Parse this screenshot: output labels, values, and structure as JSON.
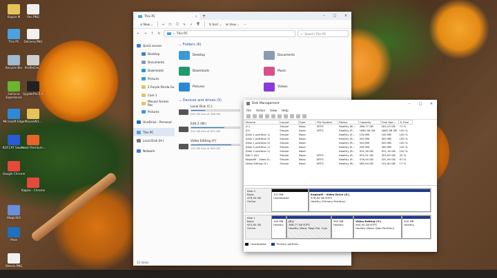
{
  "desktop": {
    "icons": [
      {
        "label": "Kagiso M",
        "col": "#e6c35a"
      },
      {
        "label": "Rec.PNG",
        "col": "#f0f0f0"
      },
      {
        "label": "This PC",
        "col": "#4aa3e0"
      },
      {
        "label": "Delivery.PNG",
        "col": "#f0f0f0"
      },
      {
        "label": "Recycle Bin",
        "col": "#9fb9d0"
      },
      {
        "label": "ProfileCre...",
        "col": "#cfcfcf"
      },
      {
        "label": "GeForce Experience",
        "col": "#6bb52f"
      },
      {
        "label": "SpyderPro 5.5",
        "col": "#222"
      },
      {
        "label": "Microsoft Edge",
        "col": "#2d8ad8"
      },
      {
        "label": "MouseWit...",
        "col": "#e6c35a"
      },
      {
        "label": "ROCCAT Swarm",
        "col": "#2a5ad8"
      },
      {
        "label": "Avast Premium...",
        "col": "#e8642a"
      },
      {
        "label": "Google Chrome",
        "col": "#e34a3b"
      },
      {
        "label": "Kagiso - Chrome",
        "col": "#e34a3b"
      },
      {
        "label": "MagicISO",
        "col": "#6b8fd8"
      },
      {
        "label": "Pexe",
        "col": "#1f6fc0"
      },
      {
        "label": "Details.PNG",
        "col": "#f0f0f0"
      }
    ]
  },
  "explorer": {
    "tab": "This PC",
    "toolbar": {
      "new": "New",
      "sort": "Sort",
      "view": "View"
    },
    "address": "This PC",
    "search_placeholder": "Search This PC",
    "sidebar": [
      {
        "label": "Quick access",
        "col": "#3a7fd4"
      },
      {
        "label": "Desktop",
        "col": "#3a7fd4"
      },
      {
        "label": "Documents",
        "col": "#8a9bb0"
      },
      {
        "label": "Downloads",
        "col": "#1f9ad8"
      },
      {
        "label": "Pictures",
        "col": "#3a9ad8"
      },
      {
        "label": "2 Purple Panda Gu",
        "col": "#e6c35a"
      },
      {
        "label": "Cam 1",
        "col": "#e6c35a"
      },
      {
        "label": "Movavi Screen Rec",
        "col": "#e6c35a"
      },
      {
        "label": "Pictures",
        "col": "#3a9ad8"
      },
      {
        "label": "OneDrive - Personal",
        "col": "#1f6fc0"
      },
      {
        "label": "This PC",
        "col": "#4aa3e0"
      },
      {
        "label": "Local Disk (H:)",
        "col": "#777"
      },
      {
        "label": "Network",
        "col": "#3a7fd4"
      }
    ],
    "folders_heading": "Folders (6)",
    "folders": [
      {
        "label": "Desktop",
        "col": "#3a9ad8"
      },
      {
        "label": "Documents",
        "col": "#8a9bb0"
      },
      {
        "label": "Downloads",
        "col": "#1f9a6a"
      },
      {
        "label": "Music",
        "col": "#d8508a"
      },
      {
        "label": "Pictures",
        "col": "#2a8ad8"
      },
      {
        "label": "Videos",
        "col": "#8a3ad8"
      }
    ],
    "drives_heading": "Devices and drives (5)",
    "drives": [
      {
        "name": "Local Disk (C:)",
        "free": "262 GB free of 366 GB",
        "used": 0.28
      },
      {
        "name": "Local Disk (H:)",
        "free": "",
        "used": 0.0
      },
      {
        "name": "Edit 2 (W:)",
        "free": "302 GB free of 931 GB",
        "used": 0.68
      },
      {
        "name": "",
        "free": "",
        "used": 0.0
      },
      {
        "name": "Video Editing (Y:)",
        "free": "102 GB free of 585 GB",
        "used": 0.83
      }
    ],
    "status": "11 items"
  },
  "diskmgmt": {
    "title": "Disk Management",
    "menu": [
      "File",
      "Action",
      "View",
      "Help"
    ],
    "headers": [
      "Volume",
      "Layout",
      "Type",
      "File System",
      "Status",
      "Capacity",
      "Free Spa...",
      "% Free"
    ],
    "rows": [
      [
        "(C:)",
        "Simple",
        "Basic",
        "NTFS",
        "Healthy (B...",
        "366,77 GB",
        "261,43 GB",
        "71 %"
      ],
      [
        "(H:)",
        "Simple",
        "Basic",
        "NTFS",
        "Healthy (P...",
        "1862,98 GB",
        "1862,98 GB",
        "100 %"
      ],
      [
        "(Disk 1 partition 1)",
        "Simple",
        "Basic",
        "",
        "Healthy (E...",
        "100 MB",
        "100 MB",
        "100 %"
      ],
      [
        "(Disk 1 partition 4)",
        "Simple",
        "Basic",
        "",
        "Healthy (R...",
        "563 MB",
        "563 MB",
        "100 %"
      ],
      [
        "(Disk 1 partition 5)",
        "Simple",
        "Basic",
        "",
        "Healthy (R...",
        "500 MB",
        "500 MB",
        "100 %"
      ],
      [
        "(Disk 2 partition 1)",
        "Simple",
        "Basic",
        "",
        "Healthy (E...",
        "260 MB",
        "260 MB",
        "100 %"
      ],
      [
        "(Disk 2 partition 2)",
        "Simple",
        "Basic",
        "",
        "Healthy (R...",
        "931,16 GB",
        "931,16 GB",
        "100 %"
      ],
      [
        "Edit 2 (W:)",
        "Simple",
        "Basic",
        "NTFS",
        "Healthy (P...",
        "931,51 GB",
        "301,63 GB",
        "32 %"
      ],
      [
        "KagisoM - Video D...",
        "Simple",
        "Basic",
        "NTFS",
        "Healthy (P...",
        "476,94 GB",
        "431,99 GB",
        "91 %"
      ],
      [
        "Video Editing (Y:)",
        "Simple",
        "Basic",
        "NTFS",
        "Healthy (B...",
        "585,94 GB",
        "101,90 GB",
        "17 %"
      ]
    ],
    "disk0": {
      "name": "Disk 0",
      "type": "Basic",
      "size": "476,94 GB",
      "state": "Online",
      "p1": {
        "size": "101 MB",
        "label": "Unallocated"
      },
      "p2": {
        "name": "KagisoM - Video Drive (X:)",
        "size": "476,84 GB NTFS",
        "status": "Healthy (Primary Partition)"
      }
    },
    "disk1": {
      "name": "Disk 1",
      "type": "Basic",
      "size": "953,85 GB",
      "state": "Online",
      "parts": [
        {
          "title": "",
          "size": "100 MB",
          "status": "Healthy"
        },
        {
          "title": "(C:)",
          "size": "366,77 GB NTFS",
          "status": "Healthy (Boot, Page File, Cras"
        },
        {
          "title": "",
          "size": "563 MB",
          "status": "Healthy"
        },
        {
          "title": "Video Editing (Y:)",
          "size": "585,94 GB NTFS",
          "status": "Healthy (Basic Data Partition)"
        },
        {
          "title": "",
          "size": "500 MB",
          "status": "Healthy"
        }
      ]
    },
    "legend": {
      "unallocated": "Unallocated",
      "primary": "Primary partition"
    }
  }
}
